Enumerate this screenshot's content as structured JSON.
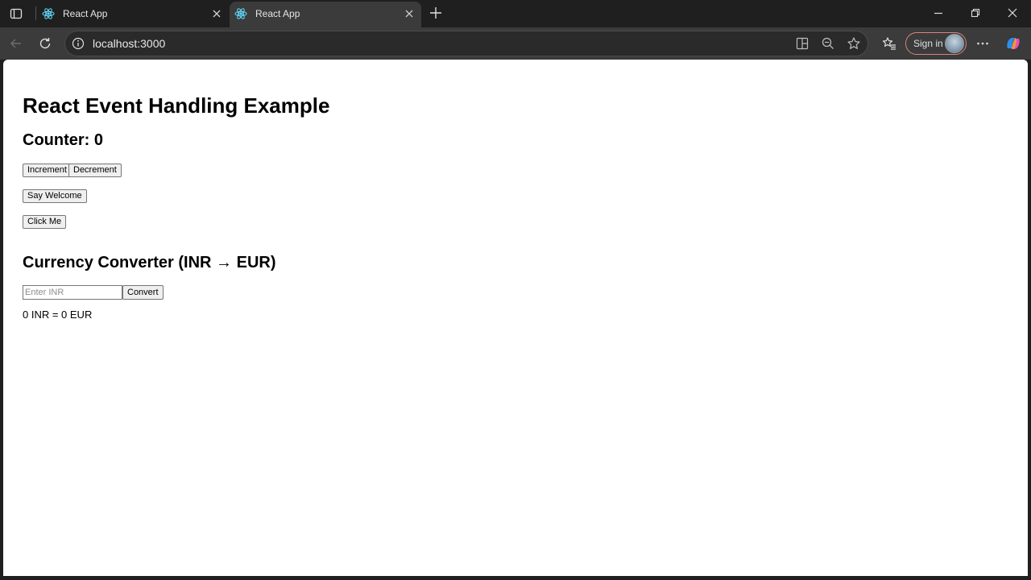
{
  "browser": {
    "tabs": [
      {
        "title": "React App",
        "active": false
      },
      {
        "title": "React App",
        "active": true
      }
    ],
    "address": "localhost:3000",
    "signin_label": "Sign in",
    "colors": {
      "accent": "#d9827c",
      "tab_active": "#3b3b3b",
      "chrome": "#1f1f1f"
    }
  },
  "page": {
    "heading": "React Event Handling Example",
    "counter_text": "Counter: 0",
    "increment_label": "Increment",
    "decrement_label": "Decrement",
    "say_welcome_label": "Say Welcome",
    "click_me_label": "Click Me",
    "converter_heading": "Currency Converter (INR → EUR)",
    "inr_input": {
      "value": "",
      "placeholder": "Enter INR"
    },
    "convert_label": "Convert",
    "result_text": "0 INR = 0 EUR"
  },
  "icons": [
    "tab-actions-icon",
    "react-favicon-icon",
    "close-icon",
    "plus-icon",
    "minimize-icon",
    "restore-icon",
    "window-close-icon",
    "back-icon",
    "reload-icon",
    "info-icon",
    "app-available-icon",
    "zoom-out-icon",
    "favorite-star-icon",
    "favorites-icon",
    "more-icon",
    "copilot-icon"
  ]
}
